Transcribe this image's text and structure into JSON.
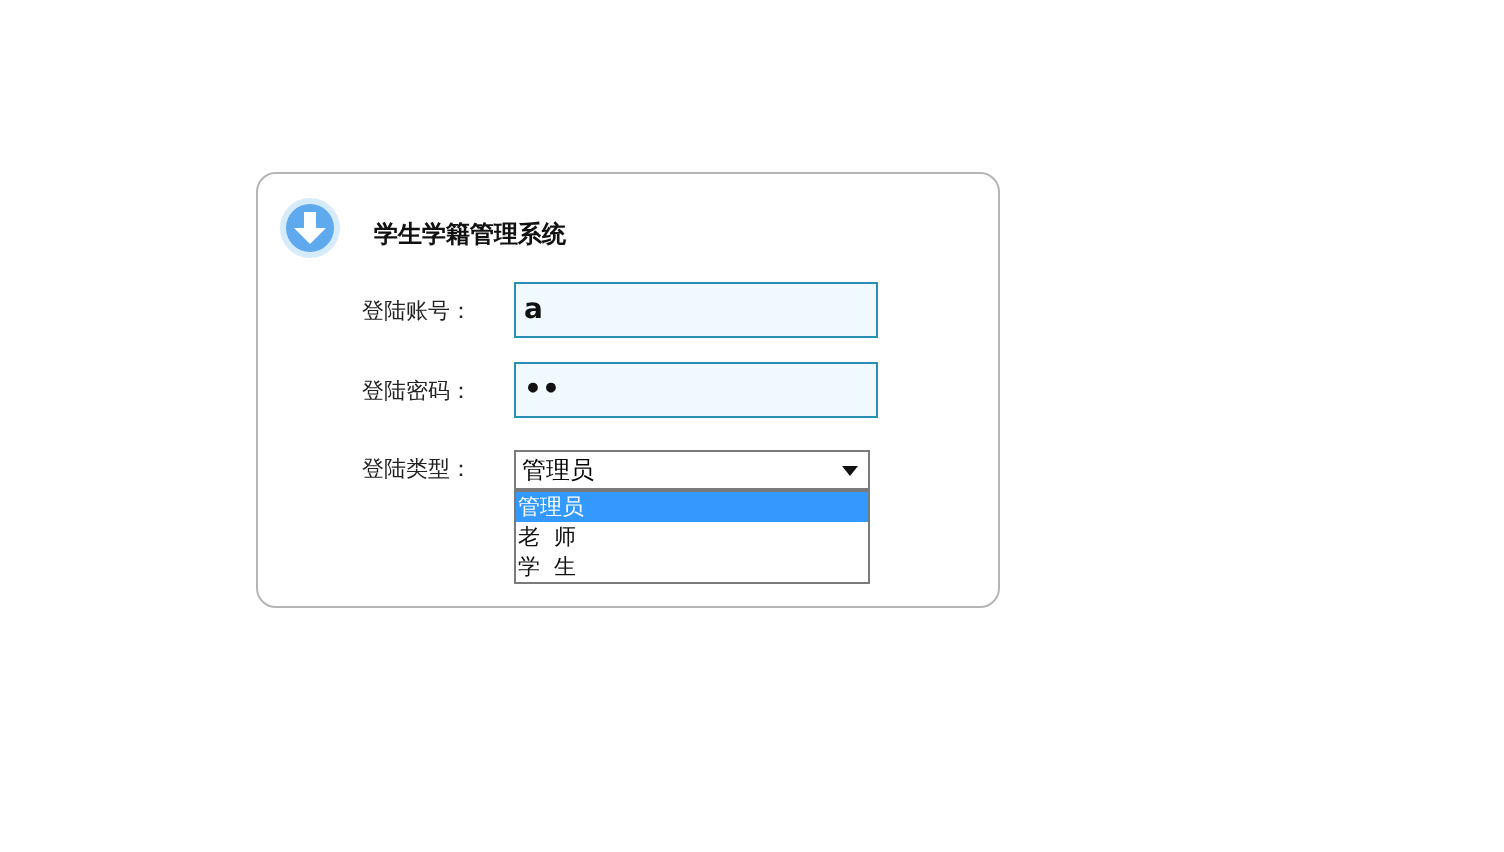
{
  "title": "学生学籍管理系统",
  "fields": [
    {
      "kind": "text",
      "label": "登陆账号：",
      "value": "a"
    },
    {
      "kind": "text",
      "label": "登陆密码：",
      "value": "••"
    },
    {
      "kind": "select",
      "label": "登陆类型：",
      "value": "管理员",
      "expanded": true,
      "options": [
        {
          "label": "管理员",
          "selected": true
        },
        {
          "label": "老  师",
          "selected": false
        },
        {
          "label": "学  生",
          "selected": false
        }
      ]
    }
  ]
}
